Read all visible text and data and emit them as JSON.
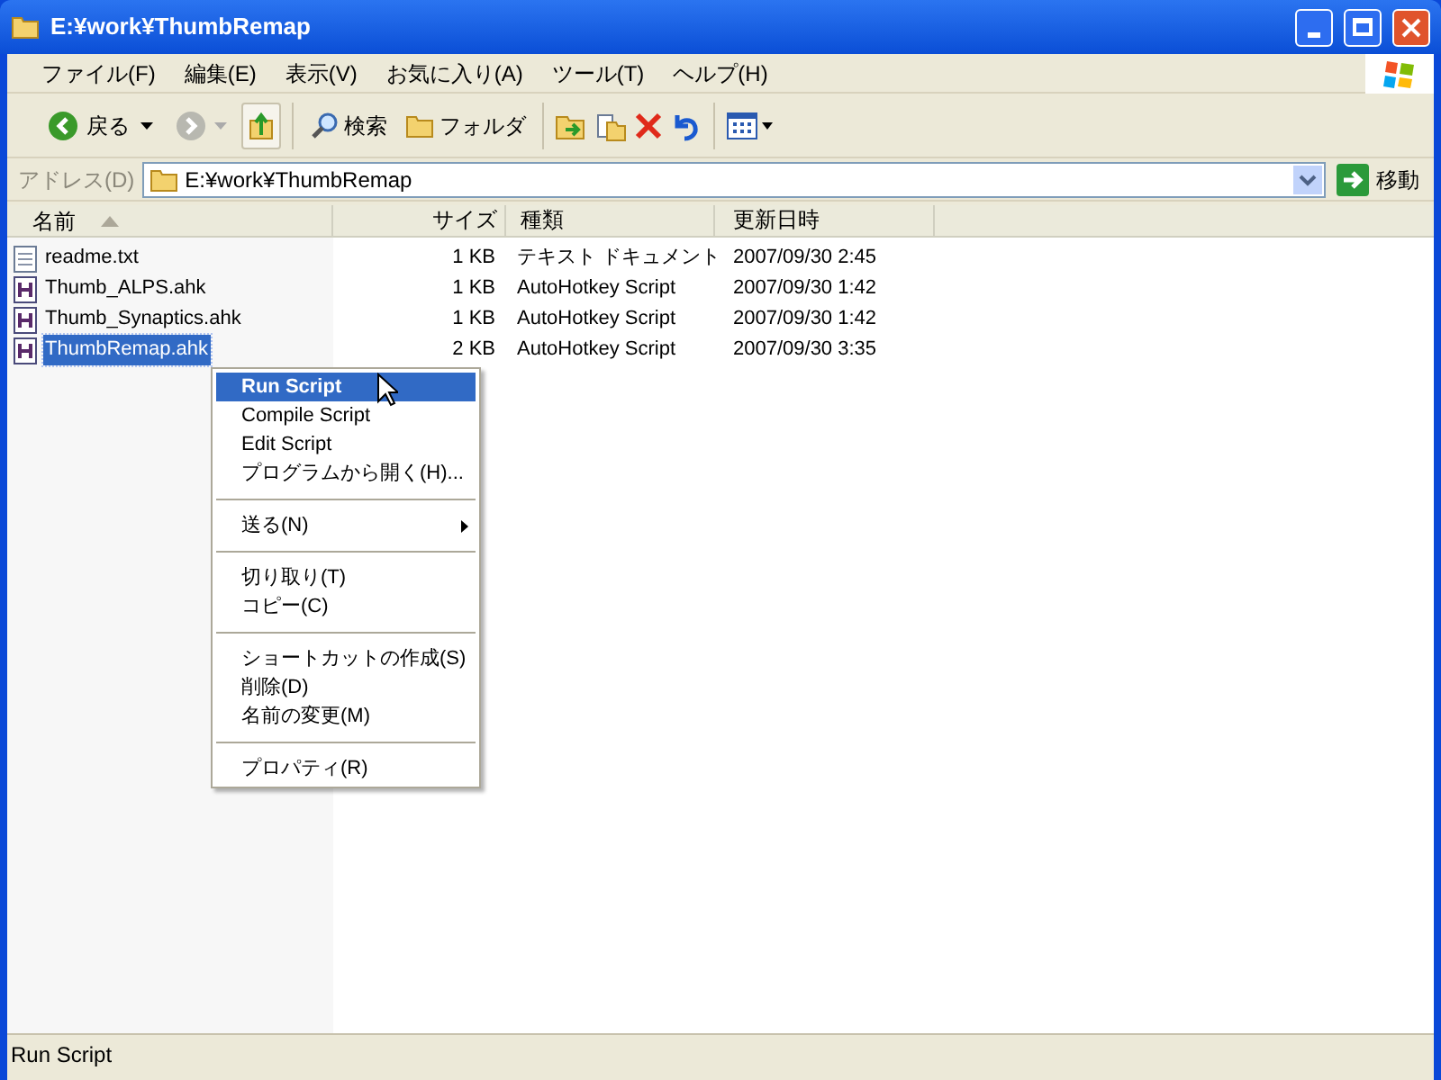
{
  "window": {
    "title": "E:¥work¥ThumbRemap"
  },
  "menu_bar": [
    "ファイル(F)",
    "編集(E)",
    "表示(V)",
    "お気に入り(A)",
    "ツール(T)",
    "ヘルプ(H)"
  ],
  "toolbar": {
    "back": "戻る",
    "search": "検索",
    "folders": "フォルダ"
  },
  "address_bar": {
    "label": "アドレス(D)",
    "value": "E:¥work¥ThumbRemap",
    "go": "移動"
  },
  "table": {
    "columns": [
      "名前",
      "サイズ",
      "種類",
      "更新日時"
    ],
    "rows": [
      {
        "kind": "text",
        "name": "readme.txt",
        "size": "1 KB",
        "type": "テキスト ドキュメント",
        "modified": "2007/09/30 2:45",
        "selected": false
      },
      {
        "kind": "script",
        "name": "Thumb_ALPS.ahk",
        "size": "1 KB",
        "type": "AutoHotkey Script",
        "modified": "2007/09/30 1:42",
        "selected": false
      },
      {
        "kind": "script",
        "name": "Thumb_Synaptics.ahk",
        "size": "1 KB",
        "type": "AutoHotkey Script",
        "modified": "2007/09/30 1:42",
        "selected": false
      },
      {
        "kind": "script",
        "name": "ThumbRemap.ahk",
        "size": "2 KB",
        "type": "AutoHotkey Script",
        "modified": "2007/09/30 3:35",
        "selected": true
      }
    ]
  },
  "context_menu": [
    {
      "kind": "item",
      "label": "Run Script",
      "default": true,
      "selected": true
    },
    {
      "kind": "item",
      "label": "Compile Script",
      "default": false,
      "selected": false
    },
    {
      "kind": "item",
      "label": "Edit Script",
      "default": false,
      "selected": false
    },
    {
      "kind": "item",
      "label": "プログラムから開く(H)...",
      "default": false,
      "selected": false
    },
    {
      "kind": "separator"
    },
    {
      "kind": "submenu",
      "label": "送る(N)",
      "default": false,
      "selected": false
    },
    {
      "kind": "separator"
    },
    {
      "kind": "item",
      "label": "切り取り(T)",
      "default": false,
      "selected": false
    },
    {
      "kind": "item",
      "label": "コピー(C)",
      "default": false,
      "selected": false
    },
    {
      "kind": "separator"
    },
    {
      "kind": "item",
      "label": "ショートカットの作成(S)",
      "default": false,
      "selected": false
    },
    {
      "kind": "item",
      "label": "削除(D)",
      "default": false,
      "selected": false
    },
    {
      "kind": "item",
      "label": "名前の変更(M)",
      "default": false,
      "selected": false
    },
    {
      "kind": "separator"
    },
    {
      "kind": "item",
      "label": "プロパティ(R)",
      "default": false,
      "selected": false
    }
  ],
  "status_bar": "Run Script"
}
